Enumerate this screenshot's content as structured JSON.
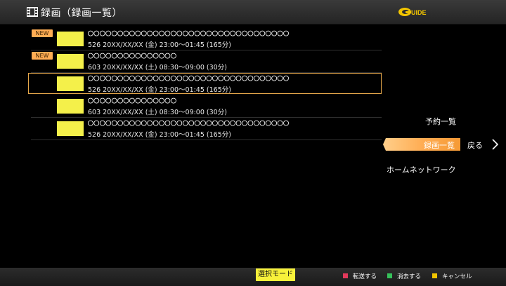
{
  "header": {
    "title": "録画（録画一覧）",
    "icon": "film-icon",
    "logo": "G GUIDE"
  },
  "recordings": [
    {
      "badge": "NEW",
      "title": "○○○○○○○○○○○○○○○○○○○○○○○○○○○○○○○○○○",
      "info": "526 20XX/XX/XX (金)  23:00～01:45 (165分)"
    },
    {
      "badge": "NEW",
      "title": "○○○○○○○○○○○○○○○",
      "info": "603 20XX/XX/XX (土)  08:30～09:00 (30分)"
    },
    {
      "badge": "",
      "title": "○○○○○○○○○○○○○○○○○○○○○○○○○○○○○○○○○○",
      "info": "526 20XX/XX/XX (金)  23:00～01:45 (165分)"
    },
    {
      "badge": "",
      "title": "○○○○○○○○○○○○○○○",
      "info": "603 20XX/XX/XX (土)  08:30～09:00 (30分)"
    },
    {
      "badge": "",
      "title": "○○○○○○○○○○○○○○○○○○○○○○○○○○○○○○○○○○",
      "info": "526 20XX/XX/XX (金)  23:00～01:45 (165分)"
    }
  ],
  "selected_index": 2,
  "side_menu": {
    "reserve": "予約一覧",
    "recordings": "録画一覧",
    "back": "戻る",
    "home_network": "ホームネットワーク"
  },
  "footer": {
    "mode": "選択モード",
    "hints": [
      {
        "color": "#e2395b",
        "label": "転送する"
      },
      {
        "color": "#36c15a",
        "label": "消去する"
      },
      {
        "color": "#f2c500",
        "label": "キャンセル"
      }
    ]
  },
  "colors": {
    "accent": "#ffad54",
    "thumb": "#f4f04a",
    "selection": "#e7a84b"
  }
}
